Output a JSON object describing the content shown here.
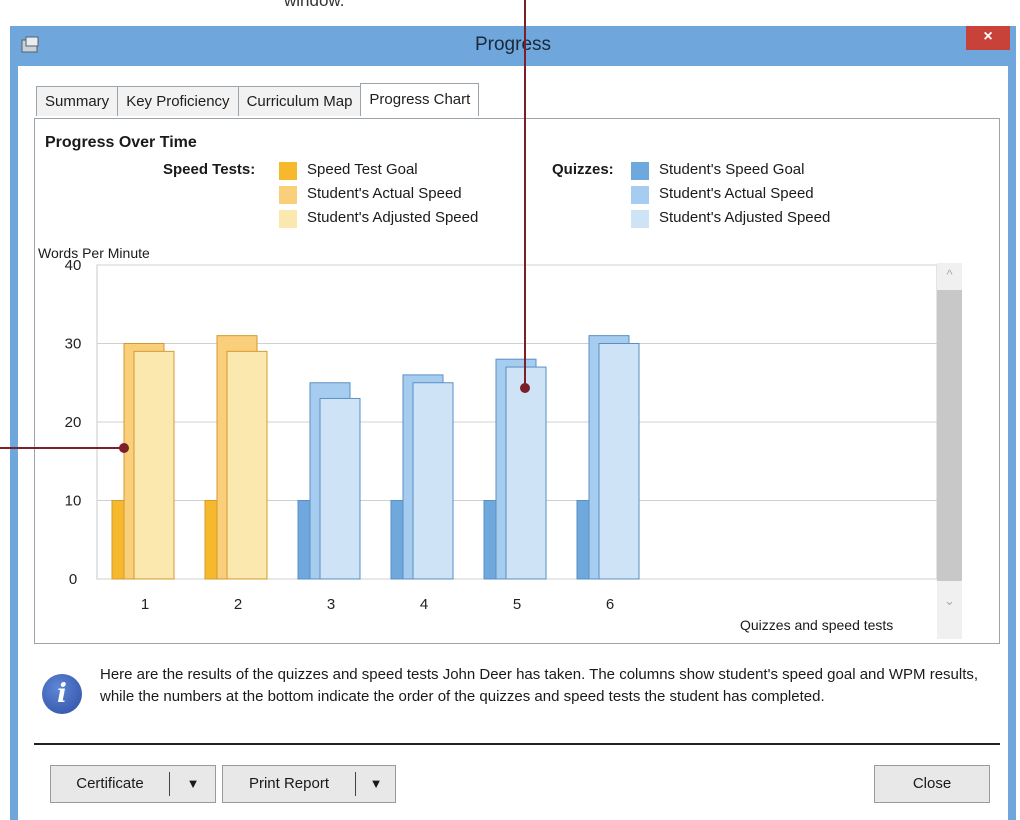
{
  "window": {
    "title": "Progress",
    "close_label": "×"
  },
  "tabs": [
    {
      "label": "Summary",
      "active": false
    },
    {
      "label": "Key Proficiency",
      "active": false
    },
    {
      "label": "Curriculum Map",
      "active": false
    },
    {
      "label": "Progress Chart",
      "active": true
    }
  ],
  "chart_panel": {
    "title": "Progress Over Time",
    "legend": {
      "speed_tests": {
        "label": "Speed Tests:",
        "items": [
          {
            "label": "Speed Test Goal",
            "color": "#f6b82c"
          },
          {
            "label": "Student's Actual Speed",
            "color": "#f9cf7c"
          },
          {
            "label": "Student's Adjusted Speed",
            "color": "#fbe8ae"
          }
        ]
      },
      "quizzes": {
        "label": "Quizzes:",
        "items": [
          {
            "label": "Student's Speed Goal",
            "color": "#6fa8dd"
          },
          {
            "label": "Student's Actual Speed",
            "color": "#a6cdef"
          },
          {
            "label": "Student's Adjusted Speed",
            "color": "#cfe3f6"
          }
        ]
      }
    }
  },
  "chart_data": {
    "type": "bar",
    "ylabel": "Words Per Minute",
    "xlabel": "Quizzes and speed tests",
    "ylim": [
      0,
      40
    ],
    "yticks": [
      0,
      10,
      20,
      30,
      40
    ],
    "grid": true,
    "categories": [
      "1",
      "2",
      "3",
      "4",
      "5",
      "6"
    ],
    "kinds": [
      "speed",
      "speed",
      "quiz",
      "quiz",
      "quiz",
      "quiz"
    ],
    "series": [
      {
        "name": "Goal",
        "values": [
          10,
          10,
          10,
          10,
          10,
          10
        ]
      },
      {
        "name": "Actual Speed",
        "values": [
          30,
          31,
          25,
          26,
          28,
          31
        ]
      },
      {
        "name": "Adjusted Speed",
        "values": [
          29,
          29,
          23,
          25,
          27,
          30
        ]
      }
    ]
  },
  "info": {
    "icon": "info-icon",
    "text": "Here are the results of the quizzes and speed tests John Deer has taken. The columns show student's speed goal and WPM results, while the numbers at the bottom indicate the order of the quizzes and speed tests the student has completed."
  },
  "buttons": {
    "certificate": "Certificate",
    "print_report": "Print Report",
    "dropdown_arrow": "▼",
    "close": "Close"
  },
  "scrollbar": {
    "up": "^",
    "down": "⌄"
  },
  "top_caption": "window."
}
